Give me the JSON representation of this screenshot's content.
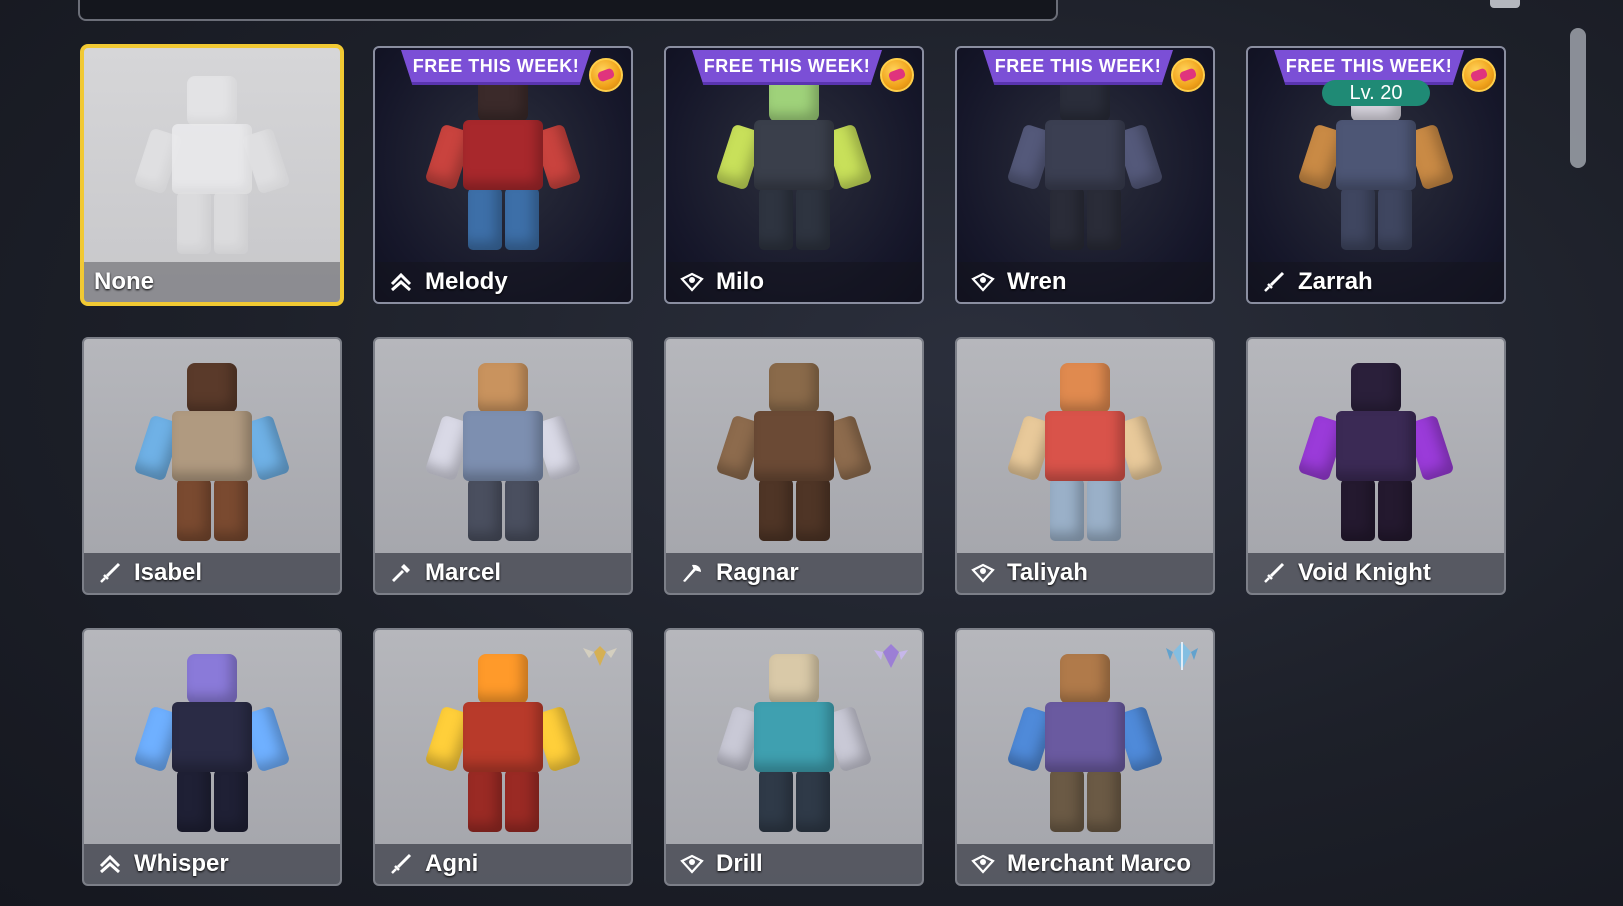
{
  "banner_text": "FREE THIS WEEK!",
  "kits": [
    {
      "name": "None",
      "class_icon": "none",
      "style": "none",
      "free": false
    },
    {
      "name": "Melody",
      "class_icon": "support-chevron-icon",
      "style": "dark",
      "free": true,
      "colors": {
        "head": "#3b2a2a",
        "body": "#a8282c",
        "arm": "#c9433e",
        "leg": "#3d6fa8"
      }
    },
    {
      "name": "Milo",
      "class_icon": "shield-eye-icon",
      "style": "dark",
      "free": true,
      "colors": {
        "head": "#9fd27a",
        "body": "#3a3f4b",
        "arm": "#c8e05a",
        "leg": "#2e3440"
      }
    },
    {
      "name": "Wren",
      "class_icon": "shield-eye-icon",
      "style": "dark",
      "free": true,
      "colors": {
        "head": "#2a2d3a",
        "body": "#3b3f52",
        "arm": "#54597a",
        "leg": "#2a2c38"
      }
    },
    {
      "name": "Zarrah",
      "class_icon": "sword-icon",
      "style": "dark",
      "free": true,
      "level": "Lv. 20",
      "colors": {
        "head": "#d9d6e0",
        "body": "#4d5675",
        "arm": "#c98a45",
        "leg": "#3f4660"
      }
    },
    {
      "name": "Isabel",
      "class_icon": "sword-icon",
      "style": "gray",
      "free": false,
      "colors": {
        "head": "#5a3a2a",
        "body": "#b09a80",
        "arm": "#6fb1e6",
        "leg": "#7a4a30"
      }
    },
    {
      "name": "Marcel",
      "class_icon": "hammer-icon",
      "style": "gray",
      "free": false,
      "colors": {
        "head": "#c9935e",
        "body": "#7d8fb0",
        "arm": "#d9d9e6",
        "leg": "#4a4f5f"
      }
    },
    {
      "name": "Ragnar",
      "class_icon": "axe-icon",
      "style": "gray",
      "free": false,
      "colors": {
        "head": "#8a6a4a",
        "body": "#6b4a35",
        "arm": "#8d6b4d",
        "leg": "#4f3526"
      }
    },
    {
      "name": "Taliyah",
      "class_icon": "shield-eye-icon",
      "style": "gray",
      "free": false,
      "colors": {
        "head": "#e08a4f",
        "body": "#d9534a",
        "arm": "#e8c99a",
        "leg": "#9ab0c8"
      }
    },
    {
      "name": "Void Knight",
      "class_icon": "sword-icon",
      "style": "gray",
      "free": false,
      "colors": {
        "head": "#2a1f3a",
        "body": "#3b2a55",
        "arm": "#9a3bd9",
        "leg": "#24192f"
      }
    },
    {
      "name": "Whisper",
      "class_icon": "support-chevron-icon",
      "style": "gray",
      "free": false,
      "colors": {
        "head": "#8a7ad9",
        "body": "#2a2b45",
        "arm": "#6fb0ff",
        "leg": "#1f2035"
      }
    },
    {
      "name": "Agni",
      "class_icon": "sword-icon",
      "style": "gray",
      "free": false,
      "rank_badge": "gold-wings-badge-icon",
      "colors": {
        "head": "#ff9a2a",
        "body": "#b83a2a",
        "arm": "#ffcf3a",
        "leg": "#9a2a24"
      }
    },
    {
      "name": "Drill",
      "class_icon": "shield-eye-icon",
      "style": "gray",
      "free": false,
      "rank_badge": "purple-crest-badge-icon",
      "colors": {
        "head": "#d9c9a8",
        "body": "#3fa0b0",
        "arm": "#c9c9d6",
        "leg": "#2f3a48"
      }
    },
    {
      "name": "Merchant Marco",
      "class_icon": "shield-eye-icon",
      "style": "gray",
      "free": false,
      "rank_badge": "diamond-crest-badge-icon",
      "colors": {
        "head": "#b07a4a",
        "body": "#6a5aa0",
        "arm": "#4f8ad9",
        "leg": "#6b5a45"
      }
    }
  ]
}
